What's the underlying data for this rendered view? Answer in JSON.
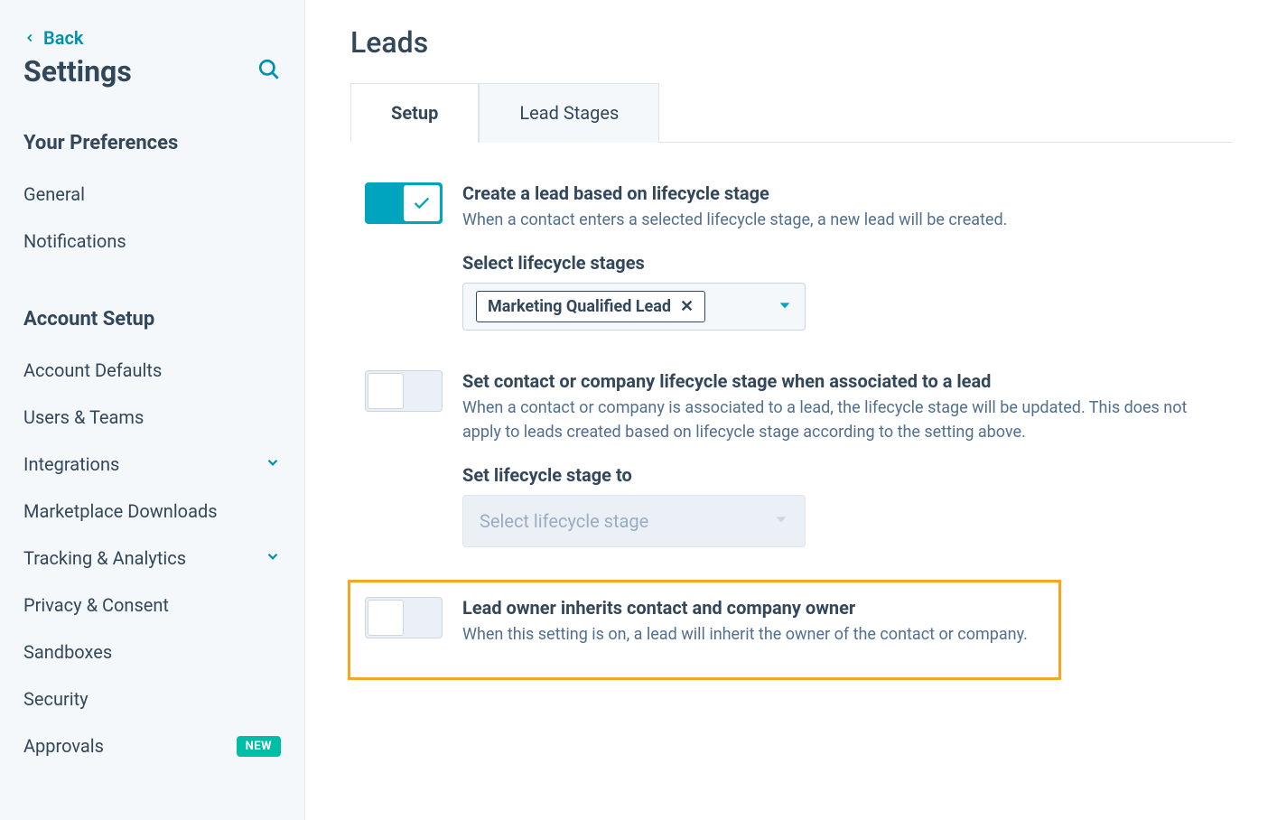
{
  "sidebar": {
    "back_label": "Back",
    "title": "Settings",
    "sections": [
      {
        "label": "Your Preferences",
        "items": [
          {
            "label": "General"
          },
          {
            "label": "Notifications"
          }
        ]
      },
      {
        "label": "Account Setup",
        "items": [
          {
            "label": "Account Defaults"
          },
          {
            "label": "Users & Teams"
          },
          {
            "label": "Integrations",
            "expandable": true
          },
          {
            "label": "Marketplace Downloads"
          },
          {
            "label": "Tracking & Analytics",
            "expandable": true
          },
          {
            "label": "Privacy & Consent"
          },
          {
            "label": "Sandboxes"
          },
          {
            "label": "Security"
          },
          {
            "label": "Approvals",
            "badge": "NEW"
          }
        ]
      }
    ]
  },
  "main": {
    "title": "Leads",
    "tabs": [
      {
        "label": "Setup",
        "active": true
      },
      {
        "label": "Lead Stages",
        "active": false
      }
    ],
    "settings": {
      "create_lead": {
        "title": "Create a lead based on lifecycle stage",
        "desc": "When a contact enters a selected lifecycle stage, a new lead will be created.",
        "field_label": "Select lifecycle stages",
        "chip_label": "Marketing Qualified Lead"
      },
      "set_stage": {
        "title": "Set contact or company lifecycle stage when associated to a lead",
        "desc": "When a contact or company is associated to a lead, the lifecycle stage will be updated. This does not apply to leads created based on lifecycle stage according to the setting above.",
        "field_label": "Set lifecycle stage to",
        "placeholder": "Select lifecycle stage"
      },
      "inherit_owner": {
        "title": "Lead owner inherits contact and company owner",
        "desc": "When this setting is on, a lead will inherit the owner of the contact or company."
      }
    }
  }
}
